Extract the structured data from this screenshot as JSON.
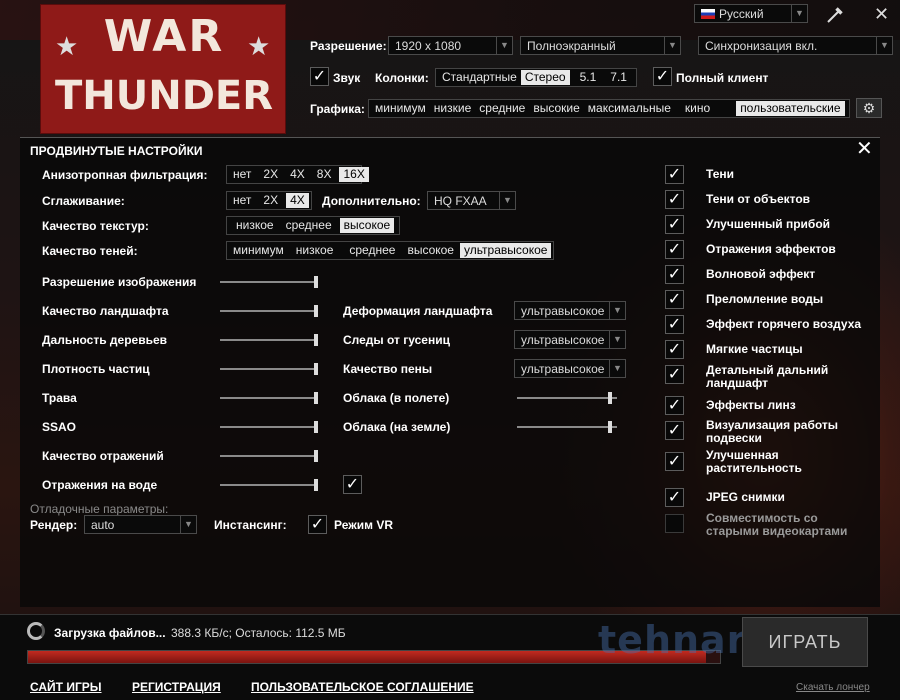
{
  "logo": {
    "line1": "WAR",
    "line2": "THUNDER"
  },
  "language": {
    "value": "Русский"
  },
  "top": {
    "resolution_label": "Разрешение:",
    "resolution_value": "1920 x 1080",
    "mode_value": "Полноэкранный",
    "vsync_value": "Синхронизация вкл.",
    "sound_label": "Звук",
    "speakers_label": "Колонки:",
    "speakers": [
      "Стандартные",
      "Стерео",
      "5.1",
      "7.1"
    ],
    "speakers_selected": "Стерео",
    "full_client_label": "Полный клиент",
    "graphics_label": "Графика:",
    "graphics": [
      "минимум",
      "низкие",
      "средние",
      "высокие",
      "максимальные",
      "кино",
      "пользовательские"
    ],
    "graphics_selected": "пользовательские"
  },
  "panel": {
    "title": "ПРОДВИНУТЫЕ НАСТРОЙКИ",
    "aniso_label": "Анизотропная фильтрация:",
    "aniso": [
      "нет",
      "2X",
      "4X",
      "8X",
      "16X"
    ],
    "aniso_selected": "16X",
    "aa_label": "Сглаживание:",
    "aa": [
      "нет",
      "2X",
      "4X"
    ],
    "aa_selected": "4X",
    "extra_label": "Дополнительно:",
    "extra_value": "HQ FXAA",
    "tex_label": "Качество текстур:",
    "tex": [
      "низкое",
      "среднее",
      "высокое"
    ],
    "tex_selected": "высокое",
    "shadow_label": "Качество теней:",
    "shadow": [
      "минимум",
      "низкое",
      "среднее",
      "высокое",
      "ультравысокое"
    ],
    "shadow_selected": "ультравысокое",
    "sliders_left": [
      {
        "label": "Разрешение изображения",
        "level": 1.0
      },
      {
        "label": "Качество ландшафта",
        "level": 1.0
      },
      {
        "label": "Дальность деревьев",
        "level": 1.0
      },
      {
        "label": "Плотность частиц",
        "level": 1.0
      },
      {
        "label": "Трава",
        "level": 1.0
      },
      {
        "label": "SSAO",
        "level": 1.0
      },
      {
        "label": "Качество отражений",
        "level": 1.0
      },
      {
        "label": "Отражения на воде",
        "level": 1.0
      }
    ],
    "mid_dropdowns": [
      {
        "label": "Деформация ландшафта",
        "value": "ультравысокое"
      },
      {
        "label": "Следы от гусениц",
        "value": "ультравысокое"
      },
      {
        "label": "Качество пены",
        "value": "ультравысокое"
      }
    ],
    "mid_sliders": [
      {
        "label": "Облака (в полете)",
        "level": 0.95
      },
      {
        "label": "Облака (на земле)",
        "level": 0.95
      }
    ],
    "debug_label": "Отладочные параметры:",
    "render_label": "Рендер:",
    "render_value": "auto",
    "instancing_label": "Инстансинг:",
    "vr_label": "Режим VR",
    "right_checks": [
      {
        "label": "Тени",
        "checked": true
      },
      {
        "label": "Тени от объектов",
        "checked": true
      },
      {
        "label": "Улучшенный прибой",
        "checked": true
      },
      {
        "label": "Отражения эффектов",
        "checked": true
      },
      {
        "label": "Волновой эффект",
        "checked": true
      },
      {
        "label": "Преломление воды",
        "checked": true
      },
      {
        "label": "Эффект горячего воздуха",
        "checked": true
      },
      {
        "label": "Мягкие частицы",
        "checked": true
      },
      {
        "label": "Детальный дальний ландшафт",
        "checked": true
      },
      {
        "label": "Эффекты линз",
        "checked": true
      },
      {
        "label": "Визуализация работы подвески",
        "checked": true
      },
      {
        "label": "Улучшенная растительность",
        "checked": true
      },
      {
        "label": "JPEG снимки",
        "checked": true
      },
      {
        "label": "Совместимость со старыми видеокартами",
        "checked": false
      }
    ]
  },
  "download": {
    "status": "Загрузка файлов...",
    "details": "388.3 КБ/с; Осталось: 112.5 МБ",
    "progress": 0.98,
    "play_label": "ИГРАТЬ"
  },
  "footer": {
    "site": "САЙТ ИГРЫ",
    "register": "РЕГИСТРАЦИЯ",
    "agreement": "ПОЛЬЗОВАТЕЛЬСКОЕ СОГЛАШЕНИЕ",
    "download_launcher": "Скачать лончер"
  },
  "watermark": "tehnari.ru",
  "colors": {
    "accent": "#8f1a18",
    "selected": "#e9e9e9",
    "progress": "#c22a20"
  }
}
